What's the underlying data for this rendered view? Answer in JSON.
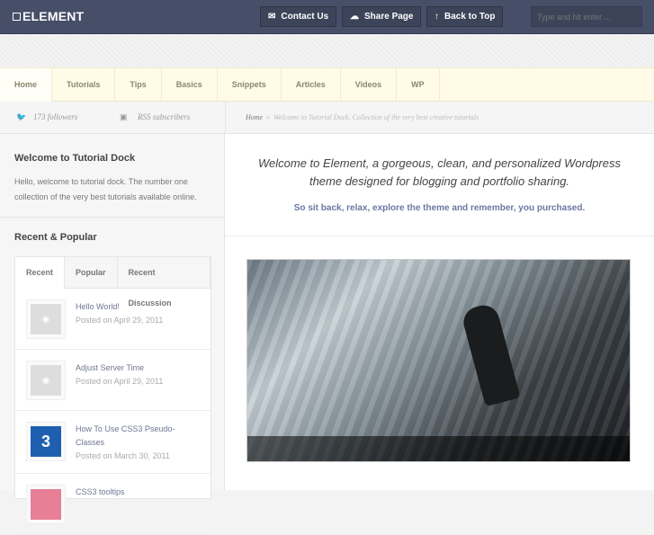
{
  "header": {
    "logo": "ELEMENT",
    "buttons": [
      {
        "label": "Contact Us",
        "icon": "mail-icon"
      },
      {
        "label": "Share Page",
        "icon": "share-icon"
      },
      {
        "label": "Back to Top",
        "icon": "arrow-up-icon"
      }
    ],
    "search_placeholder": "Type and hit enter ..."
  },
  "nav": [
    "Home",
    "Tutorials",
    "Tips",
    "Basics",
    "Snippets",
    "Articles",
    "Videos",
    "WP"
  ],
  "subbar": {
    "followers": "173 followers",
    "rss": "RSS subscribers",
    "breadcrumb_home": "Home",
    "breadcrumb_sep": "»",
    "breadcrumb_current": "Welcome to Tutorial Dock, Collection of the very best creative tutorials"
  },
  "sidebar": {
    "welcome_title": "Welcome to Tutorial Dock",
    "welcome_text": "Hello, welcome to tutorial dock. The number one collection of the very best tutorials available online.",
    "recent_title": "Recent & Popular",
    "tabs": [
      "Recent",
      "Popular",
      "Recent Discussion"
    ],
    "items": [
      {
        "title": "Hello World!",
        "date": "Posted on April 29, 2011"
      },
      {
        "title": "Adjust Server Time",
        "date": "Posted on April 29, 2011"
      },
      {
        "title": "How To Use CSS3 Pseudo-Classes",
        "date": "Posted on March 30, 2011"
      },
      {
        "title": "CSS3 tooltips",
        "date": ""
      }
    ]
  },
  "main": {
    "intro": "Welcome to Element, a gorgeous, clean, and personalized Wordpress theme designed for blogging and portfolio sharing.",
    "tagline": "So sit back, relax, explore the theme and remember, you purchased."
  },
  "colors": {
    "header": "#474e68",
    "nav": "#fffbe6",
    "link": "#6b78a3"
  }
}
